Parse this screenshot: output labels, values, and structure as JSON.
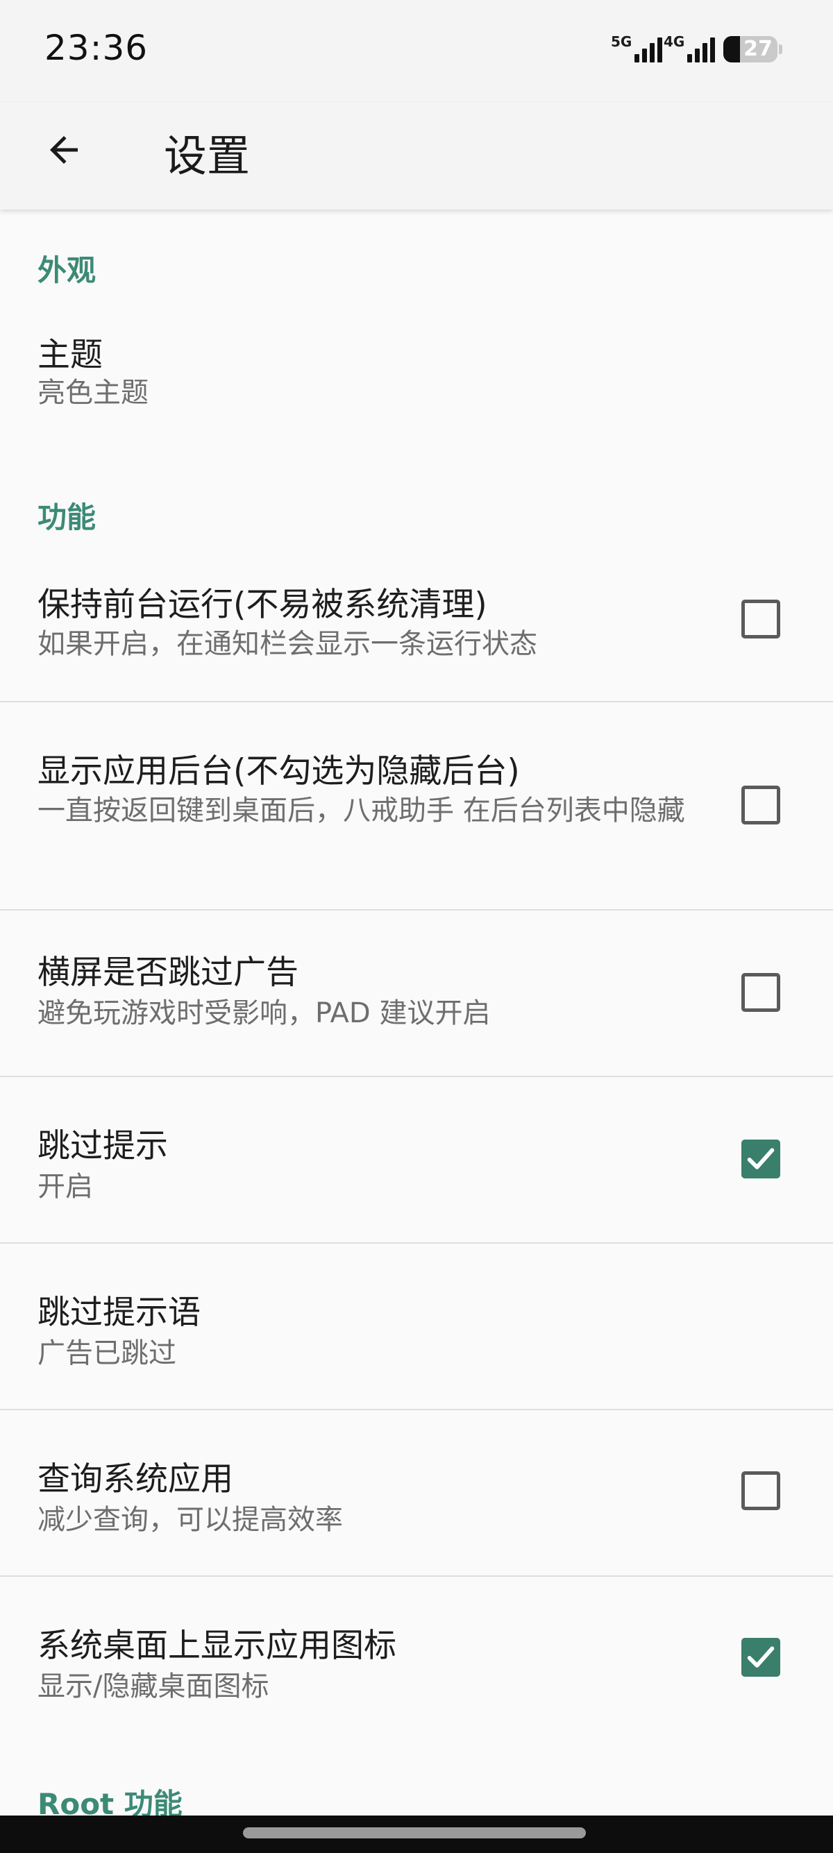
{
  "status_bar": {
    "time": "23:36",
    "signal1_label": "5G",
    "signal2_label": "4G",
    "battery_level": "27"
  },
  "app_bar": {
    "back_icon": "arrow-left-icon",
    "title": "设置"
  },
  "sections": {
    "appearance": {
      "header": "外观",
      "theme": {
        "title": "主题",
        "summary": "亮色主题"
      }
    },
    "features": {
      "header": "功能",
      "items": [
        {
          "title": "保持前台运行(不易被系统清理)",
          "summary": "如果开启，在通知栏会显示一条运行状态",
          "checked": false
        },
        {
          "title": "显示应用后台(不勾选为隐藏后台)",
          "summary": "一直按返回键到桌面后，八戒助手 在后台列表中隐藏",
          "checked": false
        },
        {
          "title": "横屏是否跳过广告",
          "summary": "避免玩游戏时受影响，PAD 建议开启",
          "checked": false
        },
        {
          "title": "跳过提示",
          "summary": "开启",
          "checked": true
        },
        {
          "title": "跳过提示语",
          "summary": "广告已跳过"
        },
        {
          "title": "查询系统应用",
          "summary": "减少查询，可以提高效率",
          "checked": false
        },
        {
          "title": "系统桌面上显示应用图标",
          "summary": "显示/隐藏桌面图标",
          "checked": true
        }
      ]
    },
    "root": {
      "header": "Root 功能"
    }
  },
  "colors": {
    "accent": "#3c8a75",
    "checkbox_checked": "#3a7f6b",
    "background": "#fafafa"
  }
}
